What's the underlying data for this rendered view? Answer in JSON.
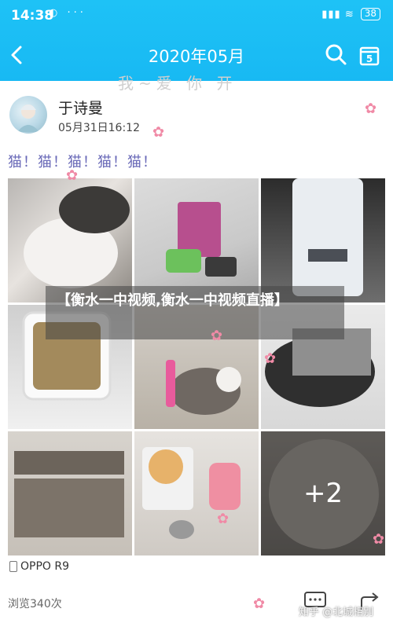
{
  "status_bar": {
    "time": "14:38",
    "left_icons": "◐ ···",
    "signal": "▮▮▮ ≋",
    "battery": "38"
  },
  "nav": {
    "title": "2020年05月",
    "back_icon": "chevron-left-icon",
    "search_icon": "search-icon",
    "calendar_icon": "calendar-icon",
    "calendar_day": "5"
  },
  "header_scribble": "我~爱 你   开",
  "post": {
    "username": "于诗曼",
    "date": "05月31日16:12",
    "text": "猫！猫！猫！猫！猫！",
    "more_count": "+2",
    "device": "OPPO R9",
    "views": "浏览340次"
  },
  "banner": {
    "text": "【衡水一中视频,衡水一中视频直播】"
  },
  "footer": {
    "watermark": "知乎 @北城相别"
  },
  "colors": {
    "header_bg": "#1ec2f6",
    "post_text": "#6a6ab8"
  }
}
